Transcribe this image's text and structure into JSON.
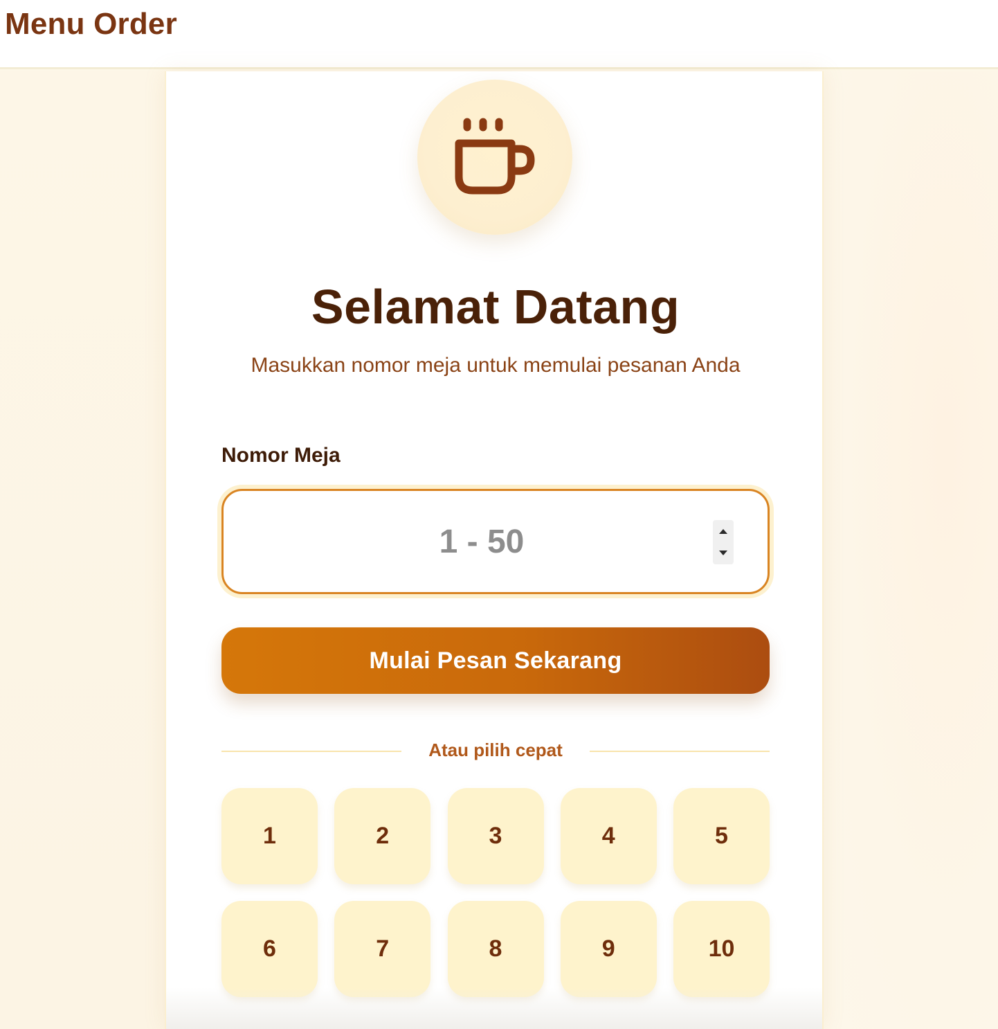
{
  "header": {
    "title": "Menu Order"
  },
  "welcome": {
    "logo_icon": "coffee-cup-icon",
    "title": "Selamat Datang",
    "subtitle": "Masukkan nomor meja untuk memulai pesanan Anda"
  },
  "table_input": {
    "label": "Nomor Meja",
    "placeholder": "1 - 50",
    "value": ""
  },
  "start_button": {
    "label": "Mulai Pesan Sekarang"
  },
  "quick_pick": {
    "divider_label": "Atau pilih cepat",
    "tables": [
      "1",
      "2",
      "3",
      "4",
      "5",
      "6",
      "7",
      "8",
      "9",
      "10"
    ]
  },
  "colors": {
    "brand_brown": "#7a3512",
    "accent_orange": "#d5770a",
    "quick_tile_bg": "#fef3cc",
    "page_bg": "#fdf7e8"
  }
}
